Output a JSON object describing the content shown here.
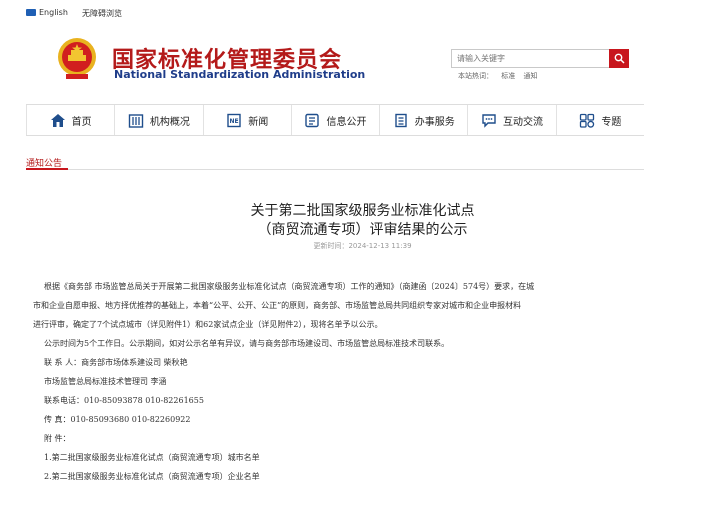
{
  "topbar": {
    "english": "English",
    "accessibility": "无障碍浏览"
  },
  "header": {
    "title_cn": "国家标准化管理委员会",
    "title_en": "National Standardization Administration"
  },
  "search": {
    "placeholder": "请输入关键字",
    "hot_label": "本站热词：",
    "hot_words": [
      "标准",
      "通知"
    ]
  },
  "nav": {
    "items": [
      {
        "label": "首页",
        "icon": "home-icon"
      },
      {
        "label": "机构概况",
        "icon": "building-icon"
      },
      {
        "label": "新闻",
        "icon": "news-icon"
      },
      {
        "label": "信息公开",
        "icon": "info-icon"
      },
      {
        "label": "办事服务",
        "icon": "service-icon"
      },
      {
        "label": "互动交流",
        "icon": "chat-icon"
      },
      {
        "label": "专题",
        "icon": "topic-icon"
      }
    ]
  },
  "section": {
    "label": "通知公告"
  },
  "article": {
    "title_line1": "关于第二批国家级服务业标准化试点",
    "title_line2": "（商贸流通专项）评审结果的公示",
    "date": "更新时间：2024-12-13 11:39",
    "lines": [
      "根据《商务部 市场监管总局关于开展第二批国家级服务业标准化试点（商贸流通专项）工作的通知》（商建函〔2024〕574号）要求，在城",
      "市和企业自愿申报、地方择优推荐的基础上，本着“公平、公开、公正”的原则，商务部、市场监管总局共同组织专家对城市和企业申报材料",
      "进行评审，确定了7个试点城市（详见附件1）和62家试点企业（详见附件2），现将名单予以公示。",
      "公示时间为5个工作日。公示期间，如对公示名单有异议，请与商务部市场建设司、市场监管总局标准技术司联系。",
      "联 系 人：商务部市场体系建设司  柴秋艳",
      "市场监管总局标准技术管理司  李涵",
      "联系电话：010-85093878  010-82261655",
      "传   真：010-85093680  010-82260922",
      "附   件：",
      "1.第二批国家级服务业标准化试点（商贸流通专项）城市名单",
      "2.第二批国家级服务业标准化试点（商贸流通专项）企业名单"
    ]
  }
}
